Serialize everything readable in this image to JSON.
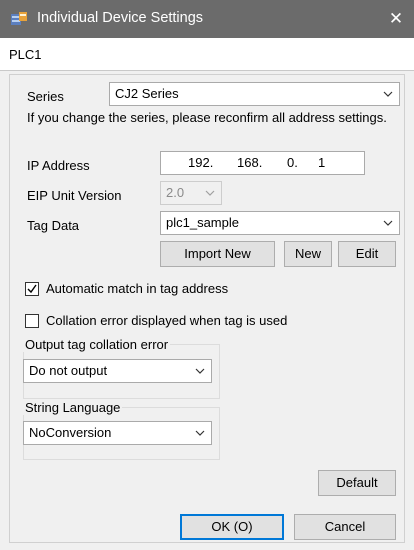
{
  "window": {
    "title": "Individual Device Settings",
    "close_glyph": "✕",
    "icon": "device-settings-icon"
  },
  "device": {
    "name": "PLC1"
  },
  "series": {
    "label": "Series",
    "value": "CJ2 Series",
    "note": "If you change the series, please reconfirm all address settings."
  },
  "ip": {
    "label": "IP Address",
    "octets": [
      "192.",
      "168.",
      "0.",
      "1"
    ]
  },
  "eip": {
    "label": "EIP Unit Version",
    "value": "2.0"
  },
  "tag_data": {
    "label": "Tag Data",
    "value": "plc1_sample",
    "import_new": "Import New",
    "new": "New",
    "edit": "Edit"
  },
  "options": {
    "auto_match": {
      "label": "Automatic match in tag address",
      "checked": true
    },
    "collation_error": {
      "label": "Collation error displayed when tag is used",
      "checked": false
    }
  },
  "output_group": {
    "title": "Output tag collation error",
    "value": "Do not output"
  },
  "string_group": {
    "title": "String Language",
    "value": "NoConversion"
  },
  "buttons": {
    "default": "Default",
    "ok": "OK (O)",
    "cancel": "Cancel"
  },
  "colors": {
    "titlebar": "#6b6b6b",
    "focus_border": "#0078d7"
  }
}
